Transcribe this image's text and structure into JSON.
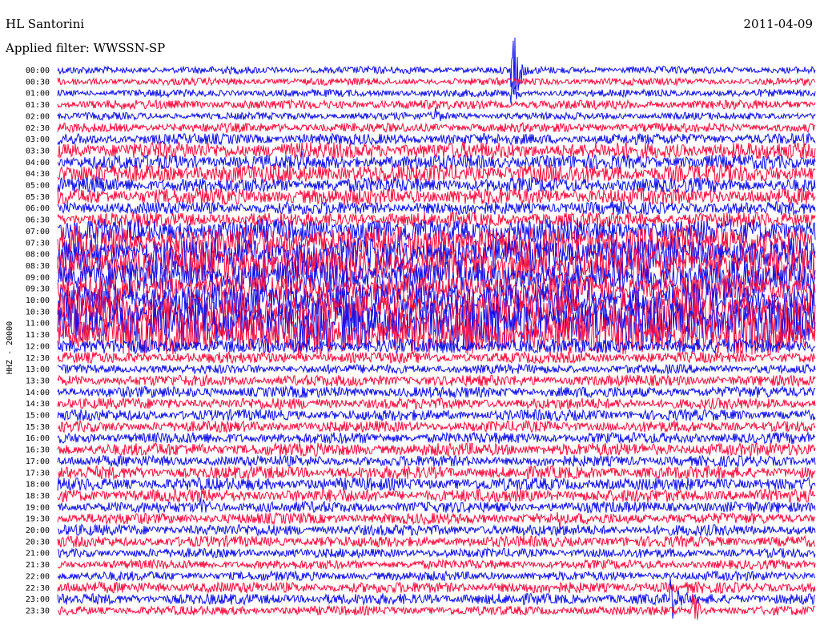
{
  "header": {
    "station": "HL Santorini",
    "filter": "Applied filter: WWSSN-SP",
    "date": "2011-04-09",
    "channel": "HHZ - 20000"
  },
  "chart_data": {
    "type": "line",
    "title": "HL Santorini",
    "subtitle": "Applied filter: WWSSN-SP",
    "ylabel": "HHZ - 20000",
    "grid": false,
    "trace_colors": [
      "#1010ee",
      "#ff0d3e"
    ],
    "row_labels": [
      "00:00",
      "00:30",
      "01:00",
      "01:30",
      "02:00",
      "02:30",
      "03:00",
      "03:30",
      "04:00",
      "04:30",
      "05:00",
      "05:30",
      "06:00",
      "06:30",
      "07:00",
      "07:30",
      "08:00",
      "08:30",
      "09:00",
      "09:30",
      "10:00",
      "10:30",
      "11:00",
      "11:30",
      "12:00",
      "12:30",
      "13:00",
      "13:30",
      "14:00",
      "14:30",
      "15:00",
      "15:30",
      "16:00",
      "16:30",
      "17:00",
      "17:30",
      "18:00",
      "18:30",
      "19:00",
      "19:30",
      "20:00",
      "20:30",
      "21:00",
      "21:30",
      "22:00",
      "22:30",
      "23:00",
      "23:30"
    ],
    "noise_amplitude": [
      4,
      4,
      4,
      5,
      4,
      5,
      6,
      9,
      8,
      10,
      8,
      9,
      7,
      8,
      13,
      18,
      18,
      19,
      18,
      15,
      18,
      22,
      26,
      22,
      8,
      6,
      5,
      6,
      6,
      6,
      6,
      6,
      6,
      7,
      6,
      7,
      7,
      7,
      6,
      6,
      6,
      6,
      5,
      5,
      5,
      6,
      6,
      5
    ],
    "events": [
      {
        "row": 0,
        "x_fraction": 0.6,
        "amplitude": 90
      },
      {
        "row": 2,
        "x_fraction": 0.6,
        "amplitude": 18
      },
      {
        "row": 4,
        "x_fraction": 0.5,
        "amplitude": 10
      },
      {
        "row": 8,
        "x_fraction": 0.32,
        "amplitude": 14
      },
      {
        "row": 10,
        "x_fraction": 0.05,
        "amplitude": 10
      },
      {
        "row": 38,
        "x_fraction": 0.19,
        "amplitude": 12
      },
      {
        "row": 39,
        "x_fraction": 0.66,
        "amplitude": 14
      },
      {
        "row": 46,
        "x_fraction": 0.81,
        "amplitude": 30
      },
      {
        "row": 47,
        "x_fraction": 0.84,
        "amplitude": 20
      }
    ]
  }
}
